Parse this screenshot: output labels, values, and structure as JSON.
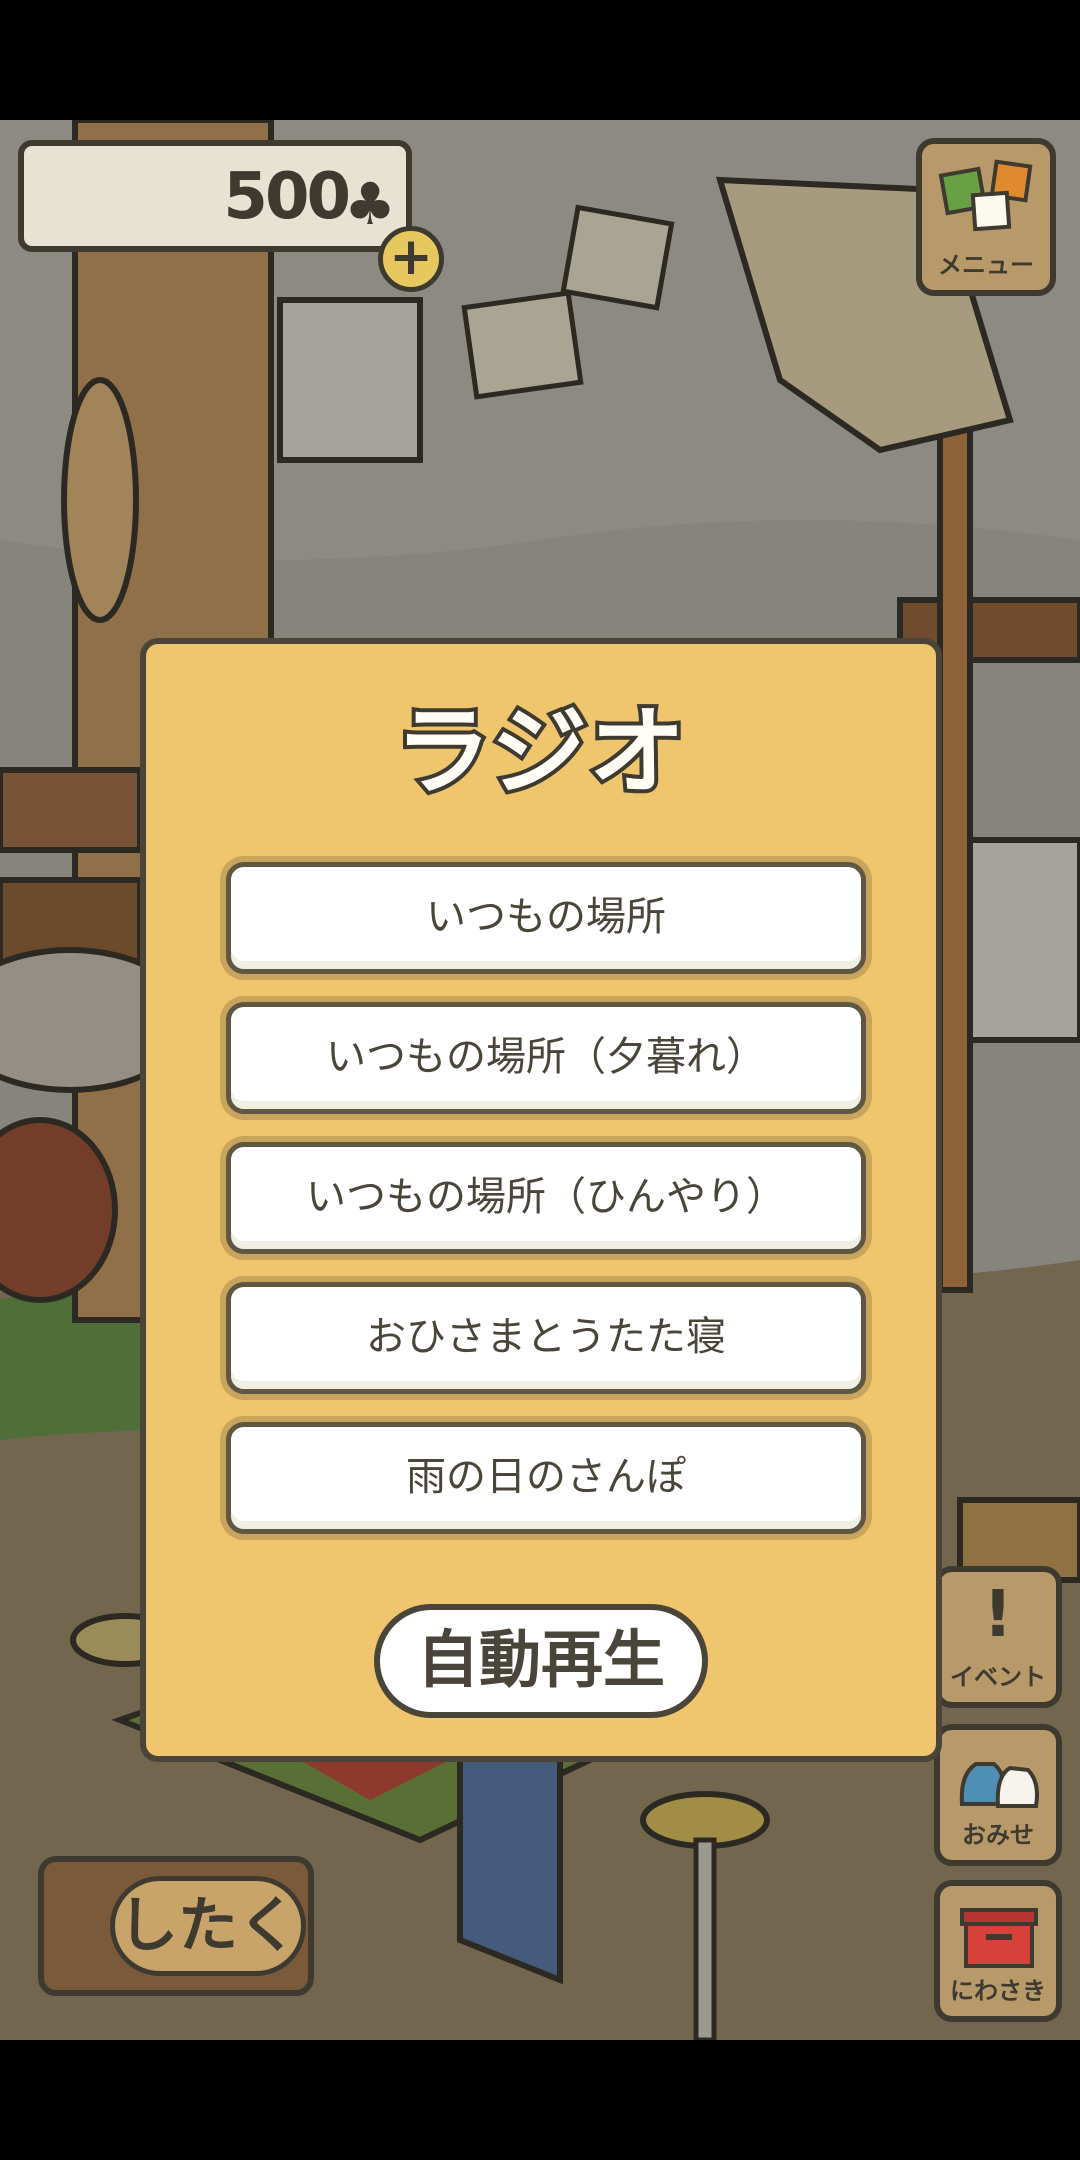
{
  "top_bar": {},
  "currency": {
    "count": "500",
    "icon": "clover-icon",
    "add_icon": "plus-icon",
    "add_label": "+"
  },
  "menu": {
    "label": "メニュー",
    "icon": "color-squares-icon"
  },
  "radio_dialog": {
    "title": "ラジオ",
    "stations": [
      {
        "label": "いつもの場所"
      },
      {
        "label": "いつもの場所（夕暮れ）"
      },
      {
        "label": "いつもの場所（ひんやり）"
      },
      {
        "label": "おひさまとうたた寝"
      },
      {
        "label": "雨の日のさんぽ"
      }
    ],
    "autoplay_label": "自動再生"
  },
  "side_buttons": {
    "event": {
      "label": "イベント",
      "icon": "exclamation-icon"
    },
    "shop": {
      "label": "おみせ",
      "icon": "bags-icon"
    },
    "garden": {
      "label": "にわさき",
      "icon": "mailbox-icon"
    }
  },
  "prepare": {
    "label": "したく"
  },
  "colors": {
    "modal_bg": "#efc56d",
    "outline": "#3e3a30",
    "button_bg": "#ffffff"
  }
}
